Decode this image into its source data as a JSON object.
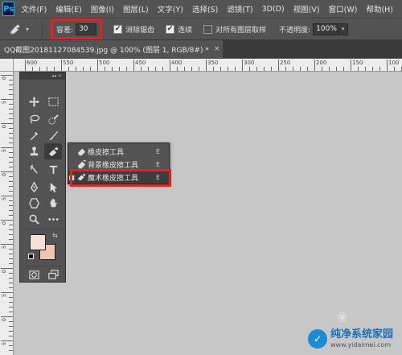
{
  "app": {
    "logo": "Ps"
  },
  "menu": [
    "文件(F)",
    "编辑(E)",
    "图像(I)",
    "图层(L)",
    "文字(Y)",
    "选择(S)",
    "滤镜(T)",
    "3D(D)",
    "视图(V)",
    "窗口(W)",
    "帮助(H)"
  ],
  "options": {
    "tool_icon": "magic-eraser-icon",
    "tolerance_label": "容差:",
    "tolerance_value": "30",
    "antialias_label": "消除锯齿",
    "antialias_checked": true,
    "contiguous_label": "连续",
    "contiguous_checked": true,
    "sample_all_label": "对所有图层取样",
    "sample_all_checked": false,
    "opacity_label": "不透明度:",
    "opacity_value": "100%"
  },
  "document": {
    "tab_title": "QQ截图20181127084539.jpg @ 100% (图层 1, RGB/8#) *",
    "close_glyph": "×"
  },
  "ruler": {
    "top_labels": [
      "600",
      "550",
      "500",
      "450",
      "400",
      "350",
      "300",
      "250",
      "200",
      "150",
      "100"
    ],
    "left_labels": [
      "0",
      "5",
      "0",
      "5",
      "0",
      "5",
      "0",
      "5",
      "0",
      "5",
      "0",
      "5"
    ]
  },
  "flyout": {
    "items": [
      {
        "label": "橡皮擦工具",
        "key": "E",
        "icon": "eraser-icon",
        "marker": ""
      },
      {
        "label": "背景橡皮擦工具",
        "key": "E",
        "icon": "background-eraser-icon",
        "marker": ""
      },
      {
        "label": "魔术橡皮擦工具",
        "key": "E",
        "icon": "magic-eraser-icon",
        "marker": "■"
      }
    ]
  },
  "colors": {
    "foreground": "#f8dfd6",
    "background": "#f2c3ad",
    "highlight_box": "#e02424"
  },
  "watermark": {
    "title": "纯净系统家园",
    "url": "www.yidaimei.com"
  }
}
